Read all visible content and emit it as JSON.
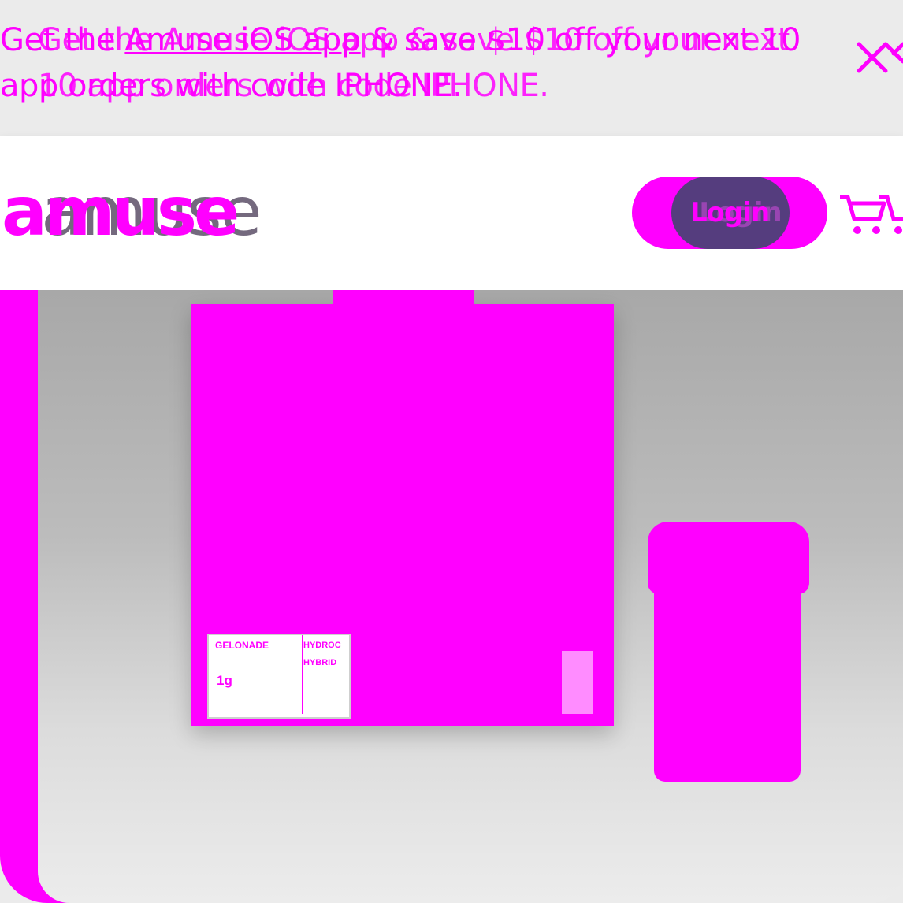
{
  "promo": {
    "line_prefix": "Get the ",
    "link_text": "Amuse iOS app",
    "line_suffix": " & save $10 off your next 10 app orders with code IPHONE.",
    "ghost_text": "Get the Amuse iOS app & save $10 off your next 10 app orders with code IPHONE."
  },
  "header": {
    "logo_text": "amuse",
    "login_label": "Login",
    "cart_icon": "cart-icon"
  },
  "product": {
    "package_brand": "GELONADE",
    "package_weight": "1g",
    "package_type_1": "HYDROC",
    "package_type_2": "HYBRID"
  },
  "colors": {
    "accent": "#ff00ff",
    "login_inner": "#553d7e",
    "background": "#ebebeb"
  }
}
